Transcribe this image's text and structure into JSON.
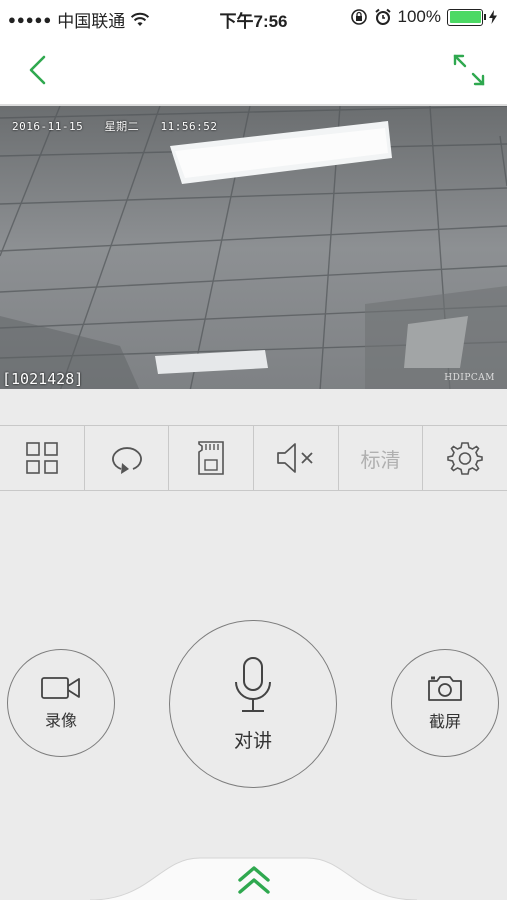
{
  "status_bar": {
    "signal": "●●●●●",
    "carrier": "中国联通",
    "time": "下午7:56",
    "battery_text": "100%"
  },
  "nav": {
    "back_icon": "chevron-left-icon",
    "expand_icon": "expand-icon",
    "accent_color": "#2fa84f"
  },
  "video": {
    "date": "2016-11-15",
    "weekday": "星期二",
    "time": "11:56:52",
    "camera_id": "[1021428]",
    "brand": "HDIPCAM"
  },
  "toolbar": {
    "items": [
      {
        "icon": "grid-icon"
      },
      {
        "icon": "playback-icon"
      },
      {
        "icon": "sd-card-icon"
      },
      {
        "icon": "mute-icon"
      },
      {
        "label": "标清"
      },
      {
        "icon": "gear-icon"
      }
    ]
  },
  "controls": {
    "record_label": "录像",
    "talk_label": "对讲",
    "screenshot_label": "截屏"
  }
}
